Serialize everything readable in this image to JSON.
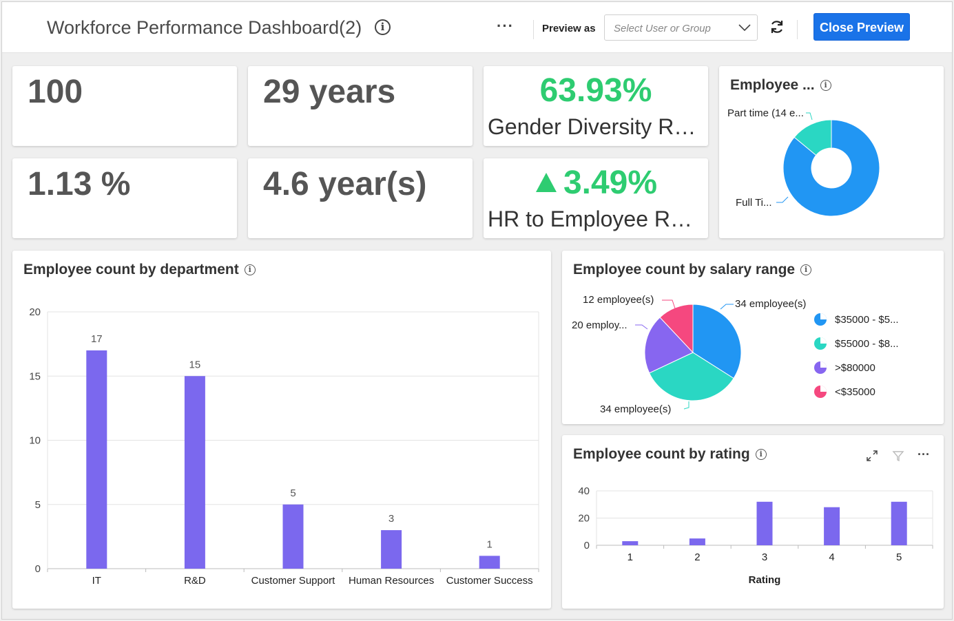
{
  "header": {
    "title": "Workforce Performance Dashboard(2)",
    "more_label": "···",
    "preview_as_label": "Preview as",
    "select_placeholder": "Select User or Group",
    "close_button_label": "Close Preview"
  },
  "kpis": [
    {
      "value": "100"
    },
    {
      "value": "29 years"
    },
    {
      "value": "63.93%",
      "label": "Gender Diversity Rat…"
    },
    {
      "value": "1.13 %"
    },
    {
      "value": "4.6 year(s)"
    },
    {
      "value": "3.49%",
      "label": "HR to Employee Ratio",
      "trend": "up"
    }
  ],
  "colors": {
    "primary": "#1a73e8",
    "positive": "#2ecc71",
    "bar": "#7b68ee",
    "blue": "#2196f3",
    "teal": "#2ad7c3",
    "purple": "#8766f0",
    "pink": "#f5487f"
  },
  "chart_data": [
    {
      "type": "pie",
      "title": "Employee ...",
      "slice_labels": [
        "Part time (14 e...",
        "Full Ti..."
      ],
      "values": [
        14,
        86
      ],
      "donut": true
    },
    {
      "type": "bar",
      "title": "Employee count by department",
      "categories": [
        "IT",
        "R&D",
        "Customer Support",
        "Human Resources",
        "Customer Success"
      ],
      "values": [
        17,
        15,
        5,
        3,
        1
      ],
      "ylim": [
        0,
        20
      ],
      "yticks": [
        0,
        5,
        10,
        15,
        20
      ],
      "grid": true
    },
    {
      "type": "pie",
      "title": "Employee count by salary range",
      "legend": [
        "$35000 - $5...",
        "$55000 - $8...",
        ">$80000",
        "<$35000"
      ],
      "legend_position": "right",
      "values": [
        34,
        34,
        20,
        12
      ],
      "slice_labels": [
        "34 employee(s)",
        "34 employee(s)",
        "20 employ...",
        "12 employee(s)"
      ]
    },
    {
      "type": "bar",
      "title": "Employee count by rating",
      "categories": [
        "1",
        "2",
        "3",
        "4",
        "5"
      ],
      "values": [
        3,
        5,
        32,
        28,
        32
      ],
      "xlabel": "Rating",
      "ylim": [
        0,
        40
      ],
      "yticks": [
        0,
        20,
        40
      ],
      "grid": true
    }
  ]
}
